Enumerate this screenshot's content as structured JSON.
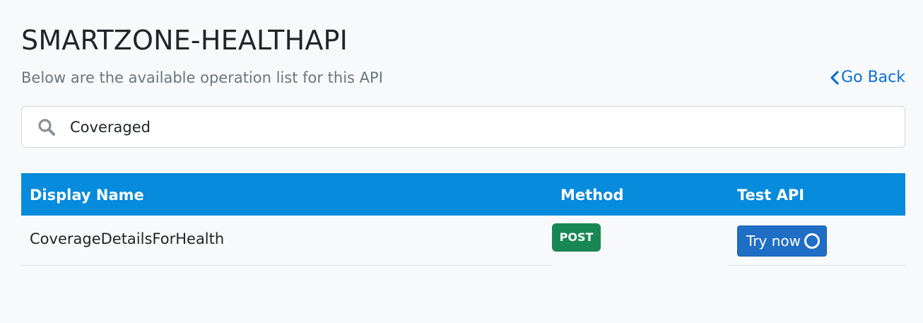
{
  "header": {
    "title": "SMARTZONE-HEALTHAPI",
    "subtitle": "Below are the available operation list for this API",
    "go_back_label": "Go Back"
  },
  "search": {
    "value": "Coveraged",
    "icon": "search-icon"
  },
  "table": {
    "columns": [
      "Display Name",
      "Method",
      "Test API"
    ],
    "rows": [
      {
        "display_name": "CoverageDetailsForHealth",
        "method": "POST",
        "test_label": "Try now"
      }
    ]
  },
  "colors": {
    "header_bg": "#078bdc",
    "post_badge": "#198754",
    "try_button": "#1f6ec6",
    "link": "#0b6fd6"
  }
}
